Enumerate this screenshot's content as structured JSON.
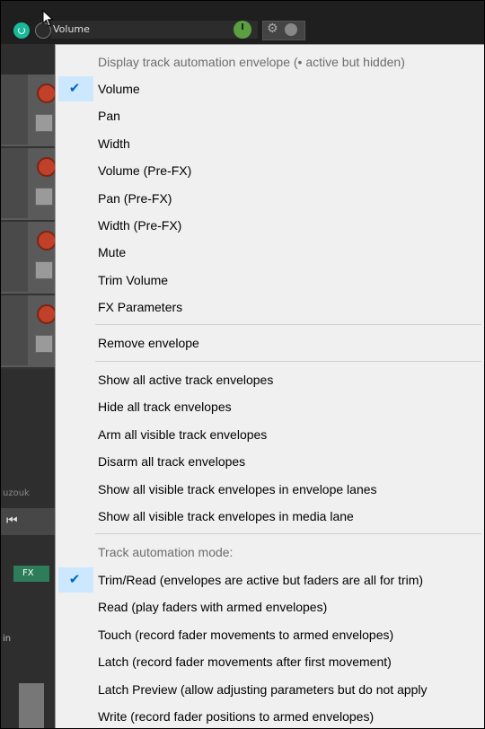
{
  "envelope_panel": {
    "name": "Volume"
  },
  "background": {
    "track_name_peek": "uzouk",
    "fx_label": "FX",
    "in_label": "in"
  },
  "context_menu": {
    "header": "Display track automation envelope (• active but hidden)",
    "check_glyph": "✔",
    "envelopes": [
      {
        "label": "Volume",
        "checked": true
      },
      {
        "label": "Pan",
        "checked": false
      },
      {
        "label": "Width",
        "checked": false
      },
      {
        "label": "Volume (Pre-FX)",
        "checked": false
      },
      {
        "label": "Pan (Pre-FX)",
        "checked": false
      },
      {
        "label": "Width (Pre-FX)",
        "checked": false
      },
      {
        "label": "Mute",
        "checked": false
      },
      {
        "label": "Trim Volume",
        "checked": false
      },
      {
        "label": "FX Parameters",
        "checked": false
      }
    ],
    "remove_envelope": "Remove envelope",
    "actions": [
      "Show all active track envelopes",
      "Hide all track envelopes",
      "Arm all visible track envelopes",
      "Disarm all track envelopes",
      "Show all visible track envelopes in envelope lanes",
      "Show all visible track envelopes in media lane"
    ],
    "mode_header": "Track automation mode:",
    "modes": [
      {
        "label": "Trim/Read (envelopes are active but faders are all for trim)",
        "checked": true
      },
      {
        "label": "Read (play faders with armed envelopes)",
        "checked": false
      },
      {
        "label": "Touch (record fader movements to armed envelopes)",
        "checked": false
      },
      {
        "label": "Latch (record fader movements after first movement)",
        "checked": false
      },
      {
        "label": "Latch Preview (allow adjusting parameters but do not apply",
        "checked": false
      },
      {
        "label": "Write (record fader positions to armed envelopes)",
        "checked": false
      }
    ]
  }
}
